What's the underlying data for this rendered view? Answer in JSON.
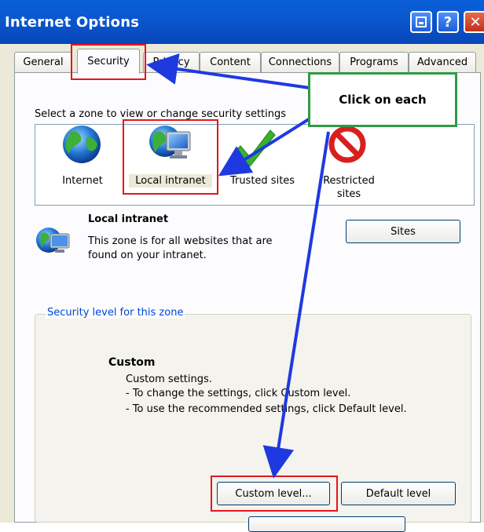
{
  "window": {
    "title": "Internet Options"
  },
  "tabs": [
    "General",
    "Security",
    "Privacy",
    "Content",
    "Connections",
    "Programs",
    "Advanced"
  ],
  "select_zone_text": "Select a zone to view or change security settings",
  "zones": [
    {
      "label": "Internet",
      "icon": "globe-icon"
    },
    {
      "label": "Local intranet",
      "icon": "intranet-icon"
    },
    {
      "label": "Trusted sites",
      "icon": "checkmark-icon"
    },
    {
      "label": "Restricted sites",
      "label_lines": [
        "Restricted",
        "sites"
      ],
      "icon": "restricted-icon"
    }
  ],
  "zone_info": {
    "title": "Local intranet",
    "desc_lines": [
      "This zone is for all websites that are",
      "found on your intranet."
    ],
    "sites_button": "Sites"
  },
  "security_level": {
    "group_label": "Security level for this zone",
    "level_title": "Custom",
    "desc_lines": [
      "Custom settings.",
      "- To change the settings, click Custom level.",
      "- To use the recommended settings, click Default level."
    ],
    "custom_button": "Custom level...",
    "default_button": "Default level"
  },
  "annotation": {
    "callout": "Click on each"
  },
  "colors": {
    "titlebar": "#0a58d0",
    "highlight": "#e8141c",
    "arrow": "#1f39e0",
    "callout_border": "#2d9b45"
  }
}
